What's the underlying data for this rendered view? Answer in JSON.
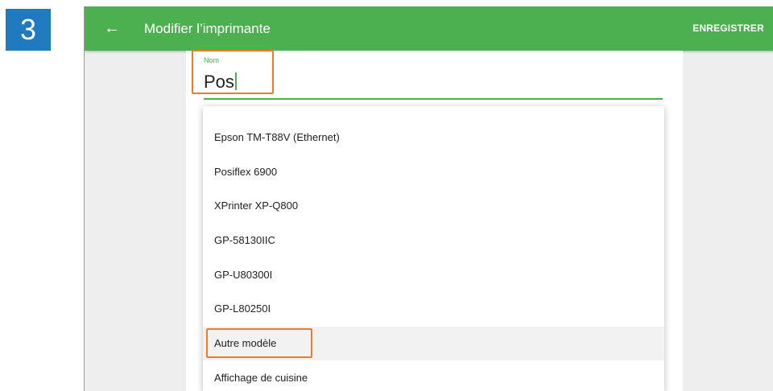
{
  "step": {
    "number": "3"
  },
  "toolbar": {
    "back_icon": "arrow-left-icon",
    "title": "Modifier l’imprimante",
    "save_label": "ENREGISTRER"
  },
  "form": {
    "name_label": "Nom",
    "name_value": "Pos"
  },
  "dropdown": {
    "items": [
      "Epson TM-T88V (Ethernet)",
      "Posiflex 6900",
      "XPrinter XP-Q800",
      "GP-58130IIC",
      "GP-U80300I",
      "GP-L80250I",
      "Autre modèle",
      "Affichage de cuisine"
    ],
    "selected": "Autre modèle"
  },
  "colors": {
    "toolbar": "#4caf50",
    "accent": "#4caf50",
    "highlight": "#e87e2c",
    "step_badge": "#1f7ac0"
  }
}
